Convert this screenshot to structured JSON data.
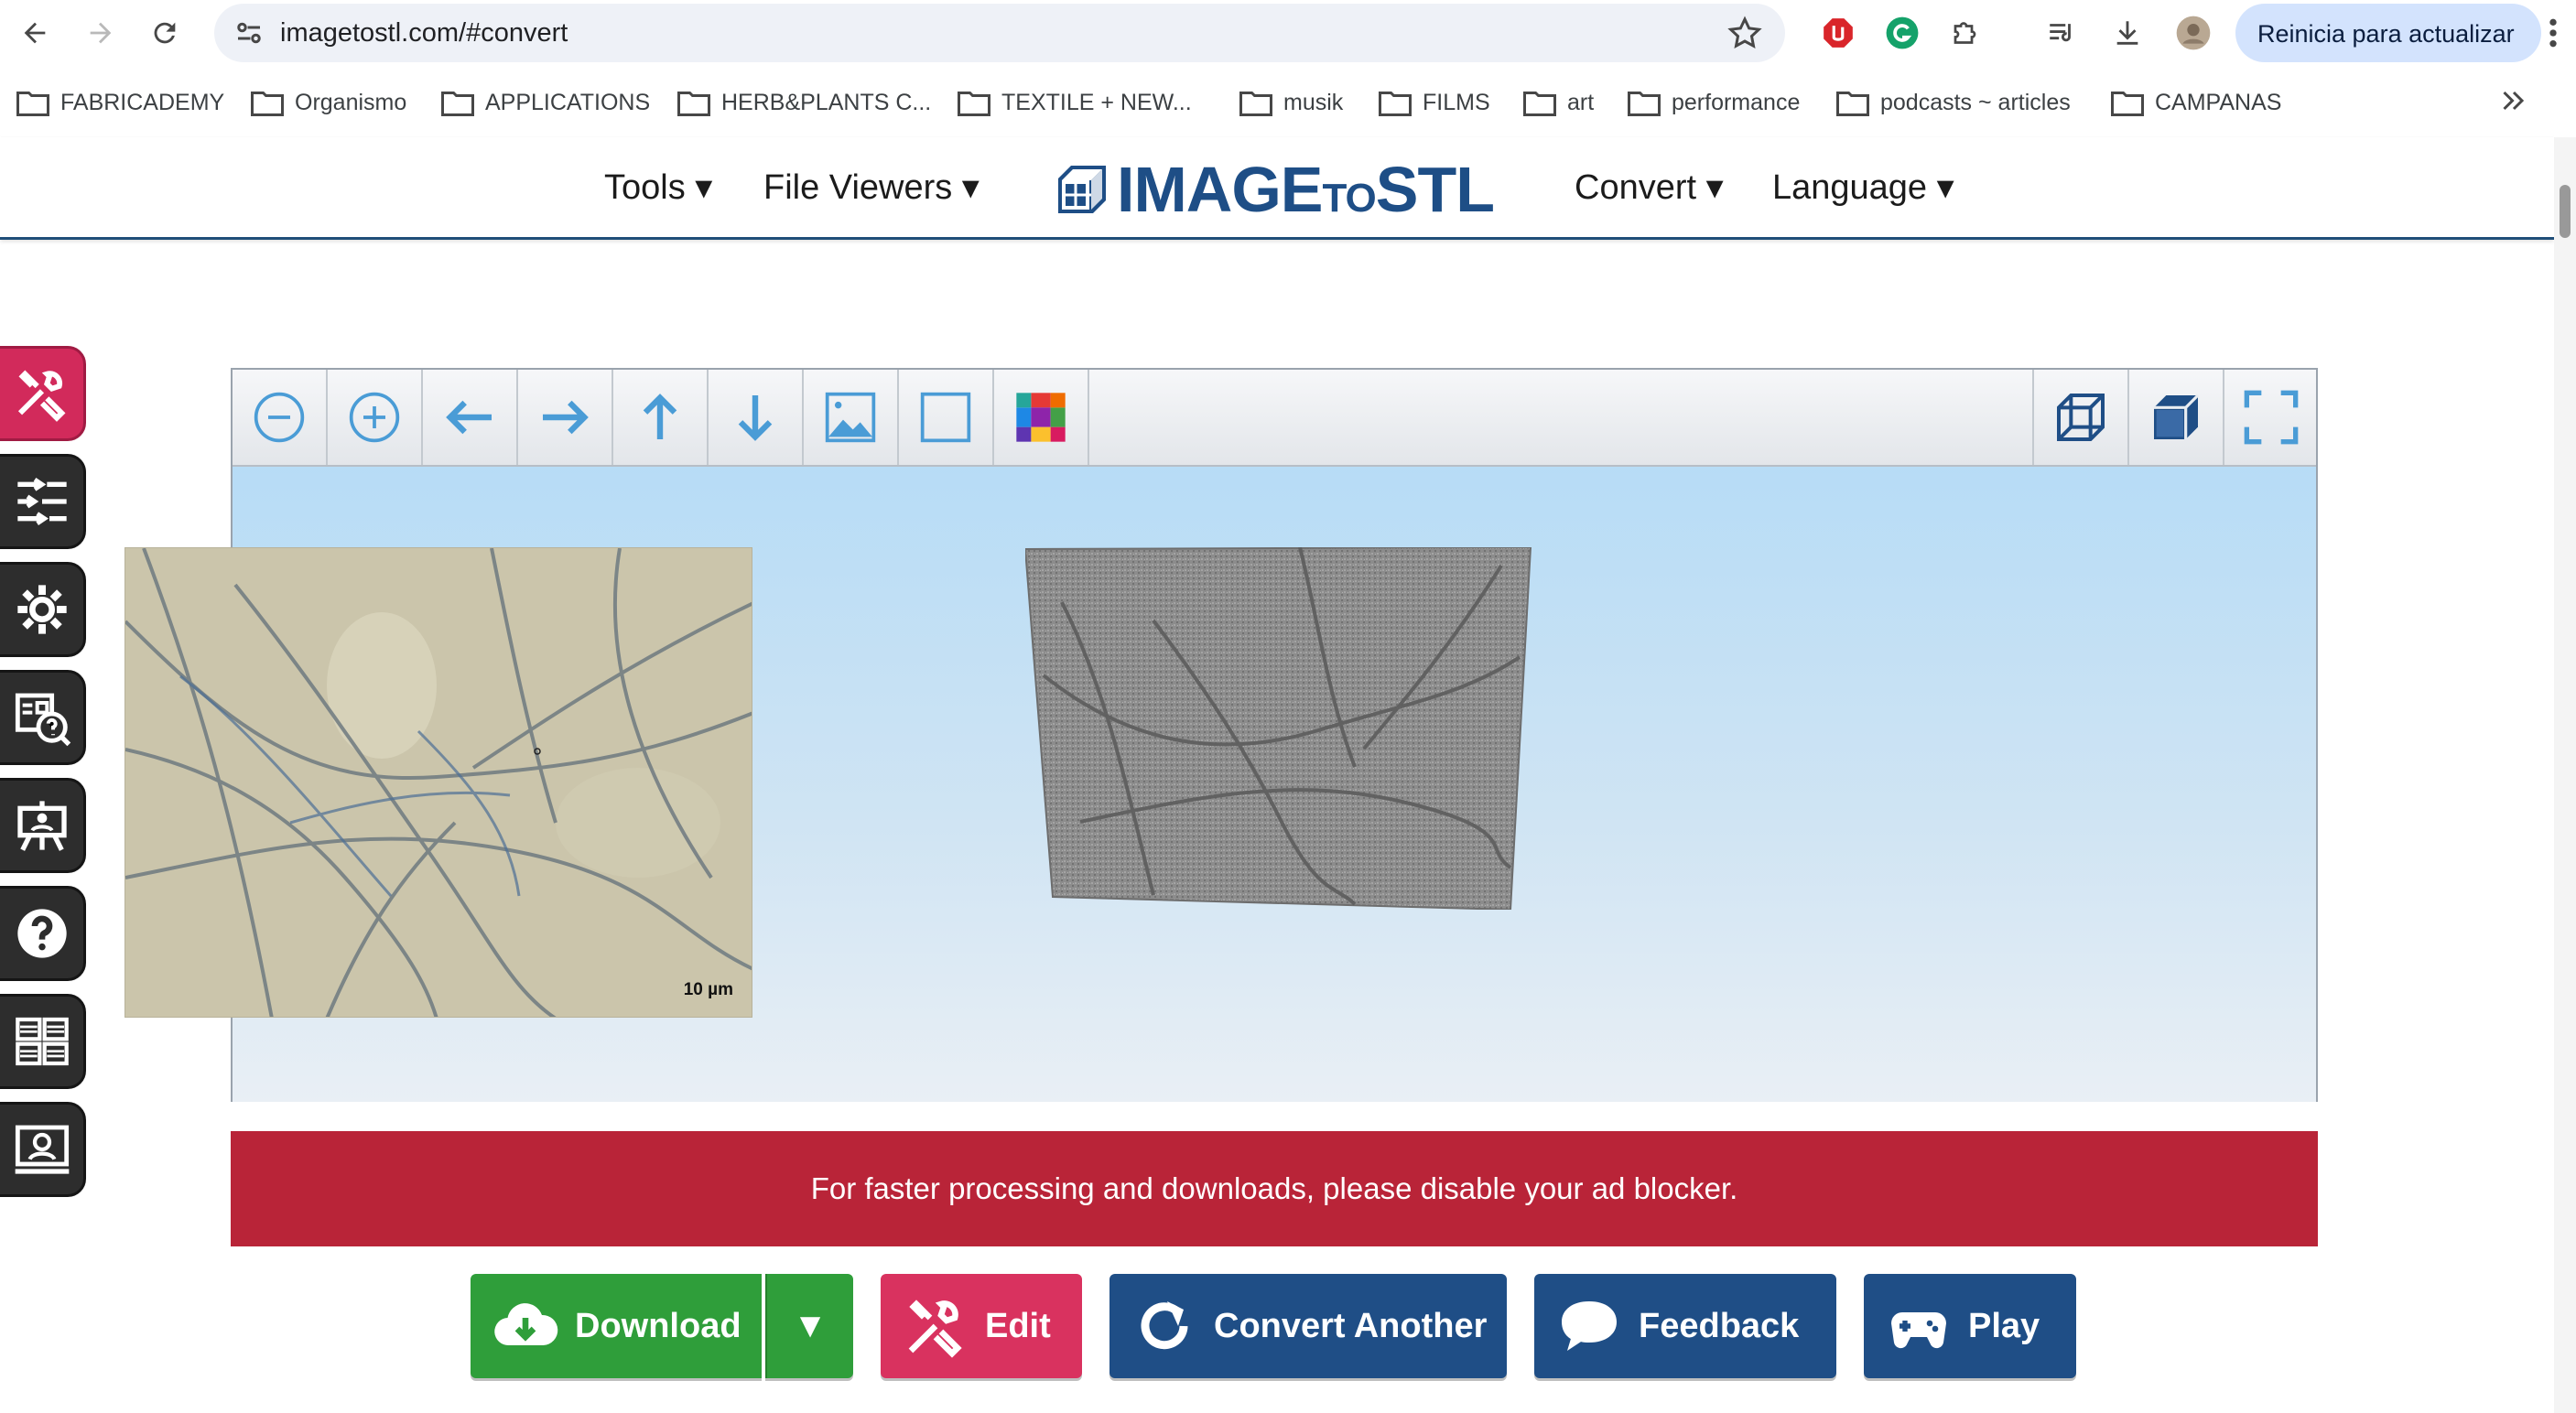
{
  "browser": {
    "url": "imagetostl.com/#convert",
    "restart_label": "Reinicia para actualizar",
    "bookmarks": [
      "FABRICADEMY",
      "Organismo",
      "APPLICATIONS",
      "HERB&PLANTS C...",
      "TEXTILE + NEW...",
      "musik",
      "FILMS",
      "art",
      "performance",
      "podcasts ~ articles",
      "CAMPANAS"
    ]
  },
  "site": {
    "menu": {
      "tools": "Tools ▾",
      "file_viewers": "File Viewers ▾",
      "convert": "Convert ▾",
      "language": "Language ▾"
    },
    "logo": {
      "main": "IMAGE",
      "small": "TO",
      "tail": "STL"
    }
  },
  "viewer": {
    "scale_label": "10 µm"
  },
  "ad_banner": "For faster processing and downloads, please disable your ad blocker.",
  "actions": {
    "download": "Download",
    "download_caret": "▼",
    "edit": "Edit",
    "convert_another": "Convert Another",
    "feedback": "Feedback",
    "play": "Play"
  },
  "colors": {
    "brand_blue": "#1f4e86",
    "download_green": "#2f9e3a",
    "edit_pink": "#d9325f",
    "banner_red": "#b92438"
  }
}
